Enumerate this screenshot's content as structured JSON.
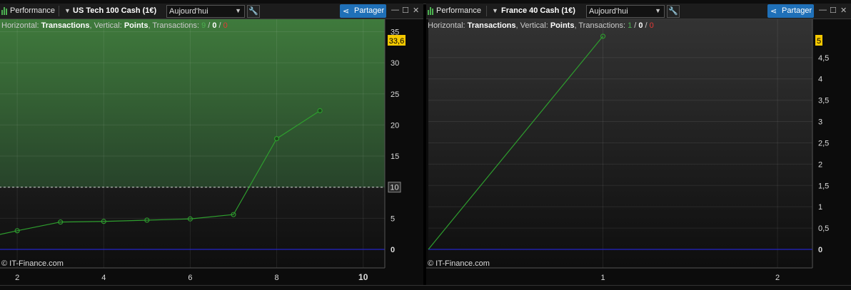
{
  "panels": [
    {
      "title": "Performance",
      "instrument": "US Tech 100 Cash (1€)",
      "period": "Aujourd'hui",
      "share_label": "Partager",
      "info": {
        "h_label": "Horizontal:",
        "h_value": "Transactions",
        "v_label": "Vertical:",
        "v_value": "Points",
        "t_label": "Transactions:",
        "t_win": "9",
        "t_even": "0",
        "t_loss": "0"
      },
      "copyright": "© IT-Finance.com"
    },
    {
      "title": "Performance",
      "instrument": "France 40 Cash (1€)",
      "period": "Aujourd'hui",
      "share_label": "Partager",
      "info": {
        "h_label": "Horizontal:",
        "h_value": "Transactions",
        "v_label": "Vertical:",
        "v_value": "Points",
        "t_label": "Transactions:",
        "t_win": "1",
        "t_even": "0",
        "t_loss": "0"
      },
      "copyright": "© IT-Finance.com"
    }
  ],
  "chart_data": [
    {
      "type": "line",
      "x": [
        0,
        1,
        2,
        3,
        4,
        5,
        6,
        7,
        8,
        9
      ],
      "y": [
        0,
        1.5,
        3,
        4.4,
        4.5,
        4.7,
        4.9,
        5.6,
        17.8,
        22.3
      ],
      "x_ticks": [
        "2",
        "4",
        "6",
        "8",
        "10"
      ],
      "y_ticks": [
        "0",
        "5",
        "10",
        "15",
        "20",
        "25",
        "30",
        "35"
      ],
      "xlim": [
        0,
        10.5
      ],
      "ylim": [
        0,
        37
      ],
      "last_value_label": "33,6",
      "reference_line": 10,
      "reference_label": "10",
      "zero_line": true,
      "grid": true,
      "colors": {
        "line": "#2e9e2e",
        "zero": "#2424c8",
        "last_badge": "#f5c800",
        "fill": "#2f5a30"
      }
    },
    {
      "type": "line",
      "x": [
        0,
        1
      ],
      "y": [
        0,
        5
      ],
      "x_ticks": [
        "1",
        "2"
      ],
      "y_ticks": [
        "0",
        "0,5",
        "1",
        "1,5",
        "2",
        "2,5",
        "3",
        "3,5",
        "4",
        "4,5"
      ],
      "xlim": [
        0,
        2.2
      ],
      "ylim": [
        0,
        5.4
      ],
      "last_value_label": "5",
      "zero_line": true,
      "grid": true,
      "colors": {
        "line": "#2e9e2e",
        "zero": "#2424c8",
        "last_badge": "#f5c800"
      }
    }
  ]
}
